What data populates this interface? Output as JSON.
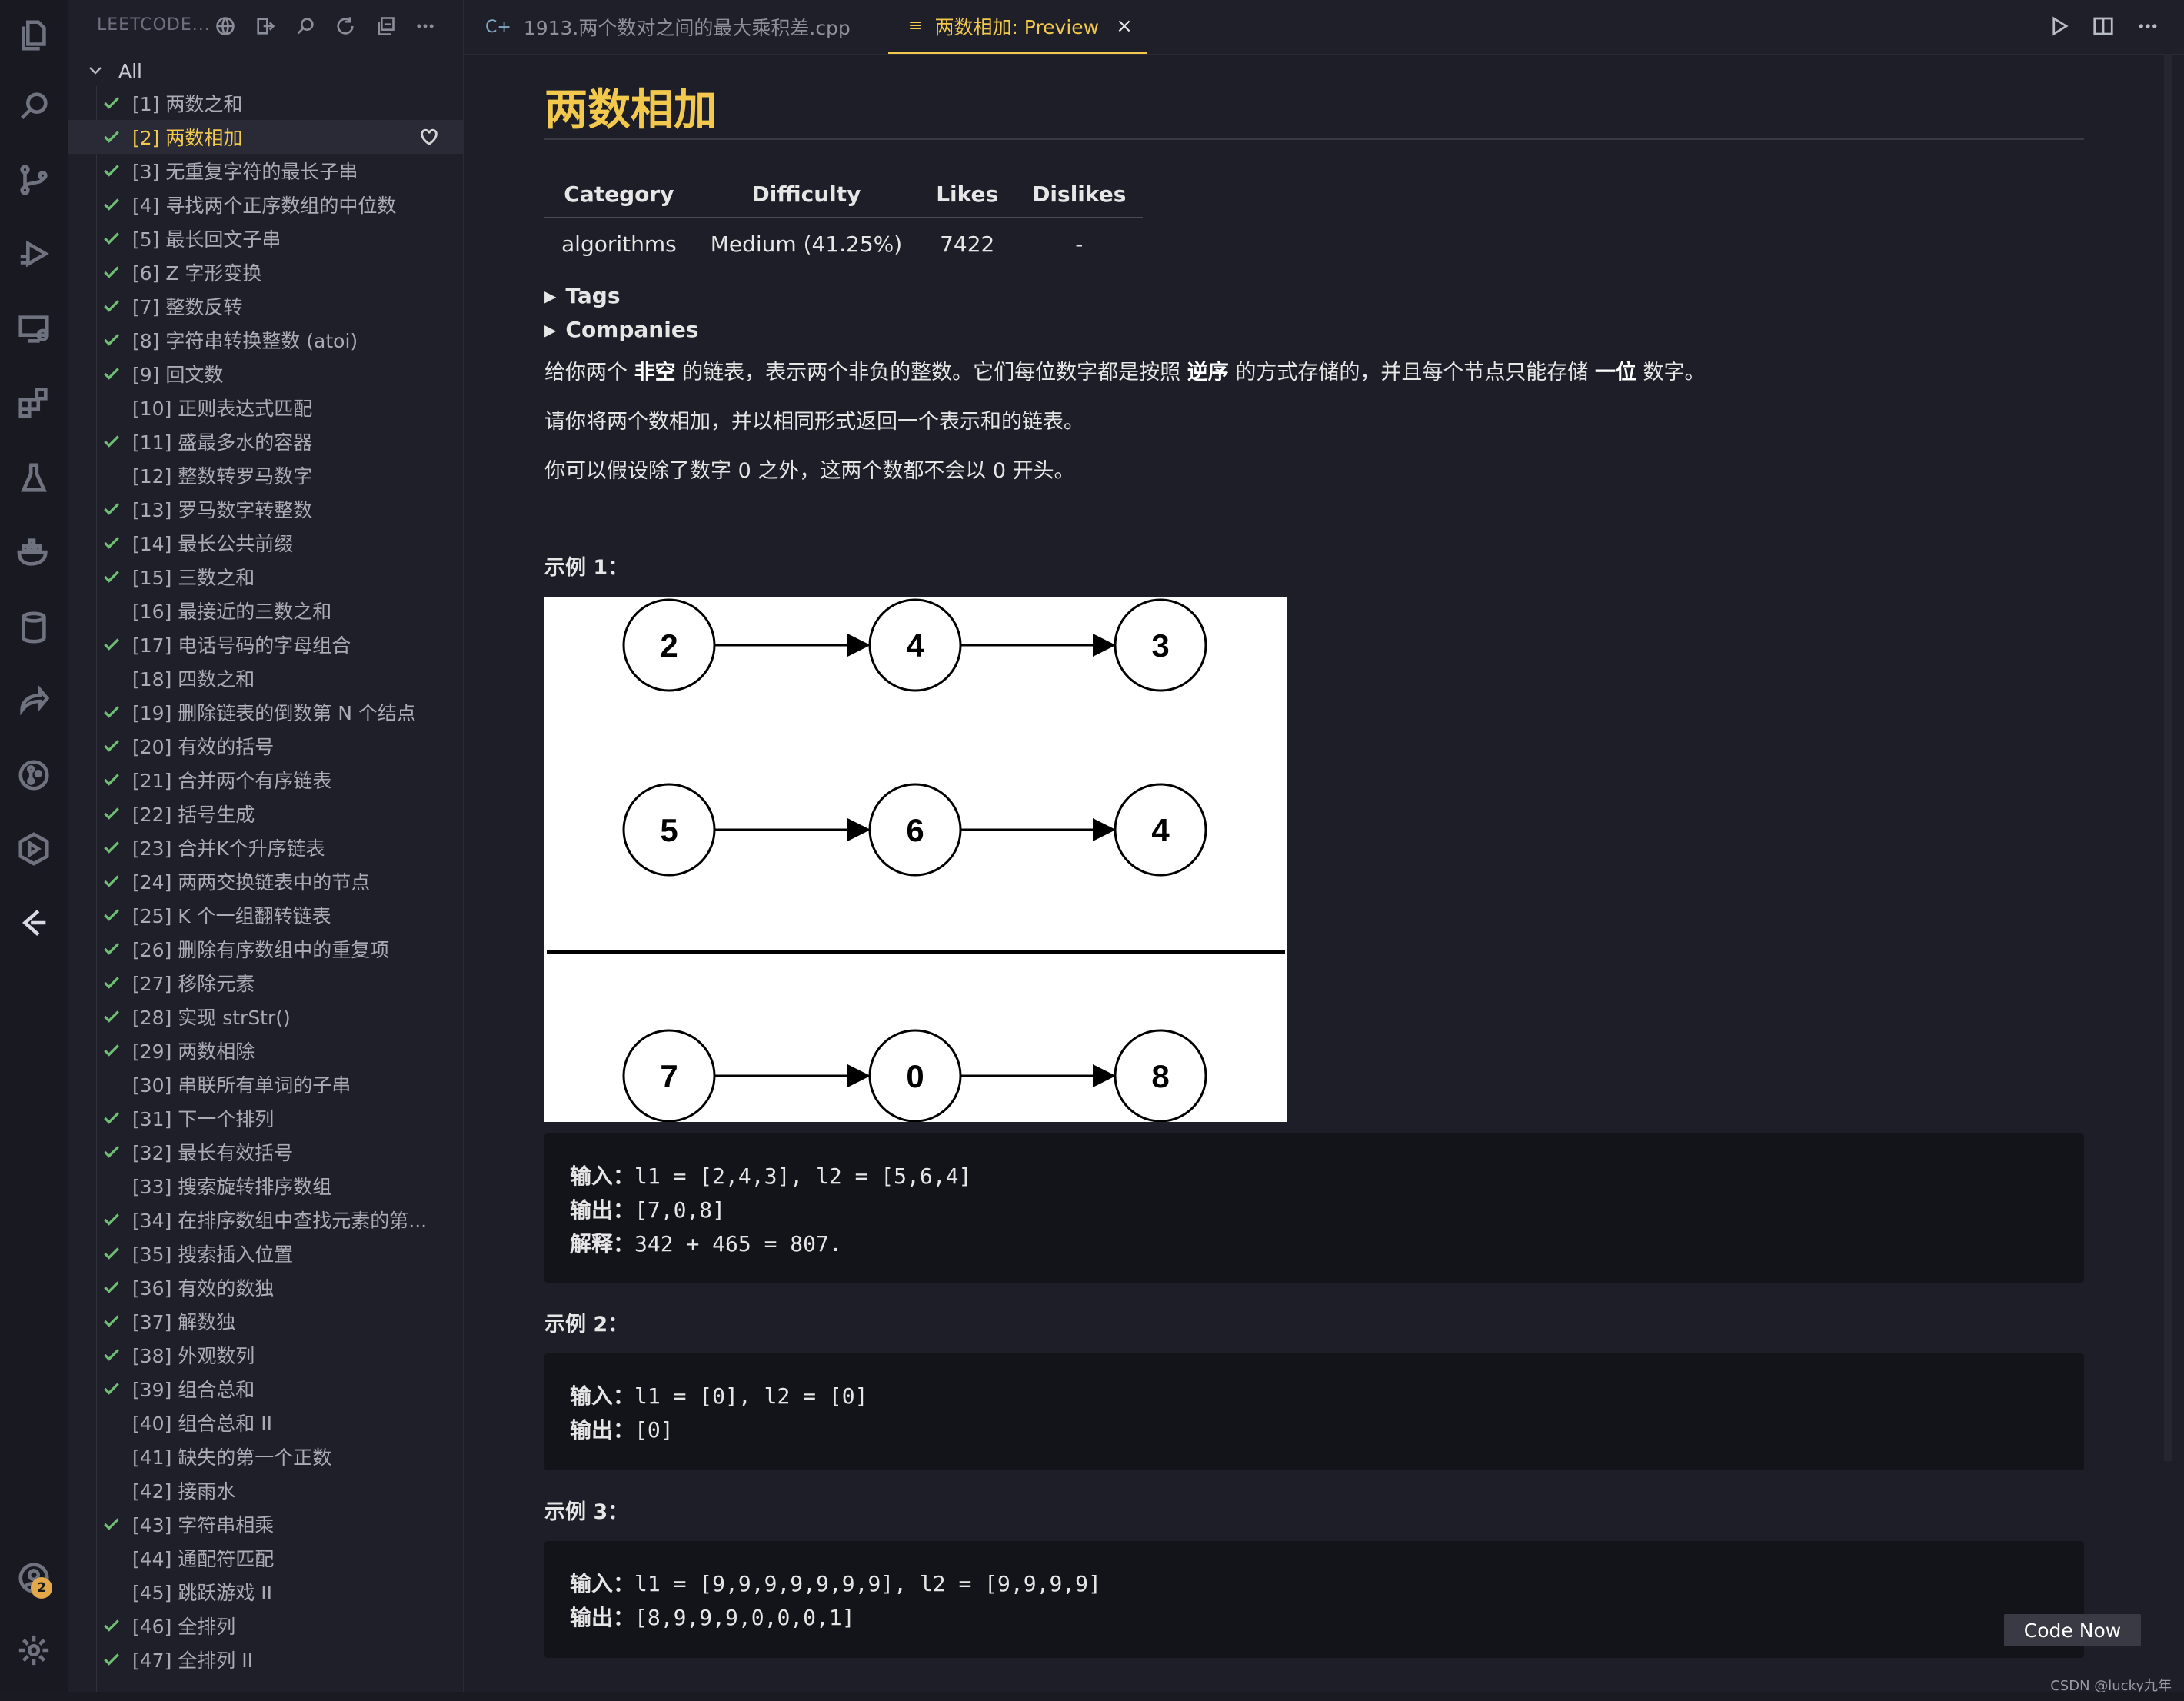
{
  "sidebar": {
    "title": "LEETCODE...",
    "root_label": "All",
    "items": [
      {
        "label": "[1] 两数之和",
        "solved": true
      },
      {
        "label": "[2] 两数相加",
        "solved": true,
        "selected": true
      },
      {
        "label": "[3] 无重复字符的最长子串",
        "solved": true
      },
      {
        "label": "[4] 寻找两个正序数组的中位数",
        "solved": true
      },
      {
        "label": "[5] 最长回文子串",
        "solved": true
      },
      {
        "label": "[6] Z 字形变换",
        "solved": true
      },
      {
        "label": "[7] 整数反转",
        "solved": true
      },
      {
        "label": "[8] 字符串转换整数 (atoi)",
        "solved": true
      },
      {
        "label": "[9] 回文数",
        "solved": true
      },
      {
        "label": "[10] 正则表达式匹配",
        "solved": false
      },
      {
        "label": "[11] 盛最多水的容器",
        "solved": true
      },
      {
        "label": "[12] 整数转罗马数字",
        "solved": false
      },
      {
        "label": "[13] 罗马数字转整数",
        "solved": true
      },
      {
        "label": "[14] 最长公共前缀",
        "solved": true
      },
      {
        "label": "[15] 三数之和",
        "solved": true
      },
      {
        "label": "[16] 最接近的三数之和",
        "solved": false
      },
      {
        "label": "[17] 电话号码的字母组合",
        "solved": true
      },
      {
        "label": "[18] 四数之和",
        "solved": false
      },
      {
        "label": "[19] 删除链表的倒数第 N 个结点",
        "solved": true
      },
      {
        "label": "[20] 有效的括号",
        "solved": true
      },
      {
        "label": "[21] 合并两个有序链表",
        "solved": true
      },
      {
        "label": "[22] 括号生成",
        "solved": true
      },
      {
        "label": "[23] 合并K个升序链表",
        "solved": true
      },
      {
        "label": "[24] 两两交换链表中的节点",
        "solved": true
      },
      {
        "label": "[25] K 个一组翻转链表",
        "solved": true
      },
      {
        "label": "[26] 删除有序数组中的重复项",
        "solved": true
      },
      {
        "label": "[27] 移除元素",
        "solved": true
      },
      {
        "label": "[28] 实现 strStr()",
        "solved": true
      },
      {
        "label": "[29] 两数相除",
        "solved": true
      },
      {
        "label": "[30] 串联所有单词的子串",
        "solved": false
      },
      {
        "label": "[31] 下一个排列",
        "solved": true
      },
      {
        "label": "[32] 最长有效括号",
        "solved": true
      },
      {
        "label": "[33] 搜索旋转排序数组",
        "solved": false
      },
      {
        "label": "[34] 在排序数组中查找元素的第...",
        "solved": true
      },
      {
        "label": "[35] 搜索插入位置",
        "solved": true
      },
      {
        "label": "[36] 有效的数独",
        "solved": true
      },
      {
        "label": "[37] 解数独",
        "solved": true
      },
      {
        "label": "[38] 外观数列",
        "solved": true
      },
      {
        "label": "[39] 组合总和",
        "solved": true
      },
      {
        "label": "[40] 组合总和 II",
        "solved": false
      },
      {
        "label": "[41] 缺失的第一个正数",
        "solved": false
      },
      {
        "label": "[42] 接雨水",
        "solved": false
      },
      {
        "label": "[43] 字符串相乘",
        "solved": true
      },
      {
        "label": "[44] 通配符匹配",
        "solved": false
      },
      {
        "label": "[45] 跳跃游戏 II",
        "solved": false
      },
      {
        "label": "[46] 全排列",
        "solved": true
      },
      {
        "label": "[47] 全排列 II",
        "solved": true
      }
    ]
  },
  "tabs": [
    {
      "label": "1913.两个数对之间的最大乘积差.cpp",
      "active": false
    },
    {
      "label": "两数相加: Preview",
      "active": true
    }
  ],
  "activity_badge": "2",
  "preview": {
    "title": "两数相加",
    "table": {
      "headers": [
        "Category",
        "Difficulty",
        "Likes",
        "Dislikes"
      ],
      "row": [
        "algorithms",
        "Medium (41.25%)",
        "7422",
        "-"
      ]
    },
    "tags_label": "Tags",
    "companies_label": "Companies",
    "desc1": {
      "pre": "给你两个 ",
      "b1": "非空",
      "mid1": " 的链表，表示两个非负的整数。它们每位数字都是按照 ",
      "b2": "逆序",
      "mid2": " 的方式存储的，并且每个节点只能存储 ",
      "b3": "一位",
      "post": " 数字。"
    },
    "desc2": "请你将两个数相加，并以相同形式返回一个表示和的链表。",
    "desc3": "你可以假设除了数字 0 之外，这两个数都不会以 0 开头。",
    "example1_title": "示例 1：",
    "example1": [
      {
        "k": "输入：",
        "v": "l1 = [2,4,3], l2 = [5,6,4]"
      },
      {
        "k": "输出：",
        "v": "[7,0,8]"
      },
      {
        "k": "解释：",
        "v": "342 + 465 = 807."
      }
    ],
    "example2_title": "示例 2：",
    "example2": [
      {
        "k": "输入：",
        "v": "l1 = [0], l2 = [0]"
      },
      {
        "k": "输出：",
        "v": "[0]"
      }
    ],
    "example3_title": "示例 3：",
    "example3": [
      {
        "k": "输入：",
        "v": "l1 = [9,9,9,9,9,9,9], l2 = [9,9,9,9]"
      },
      {
        "k": "输出：",
        "v": "[8,9,9,9,0,0,0,1]"
      }
    ],
    "diagram_rows": [
      [
        "2",
        "4",
        "3"
      ],
      [
        "5",
        "6",
        "4"
      ],
      [
        "7",
        "0",
        "8"
      ]
    ]
  },
  "code_now_label": "Code Now",
  "watermark": "CSDN @lucky九年"
}
